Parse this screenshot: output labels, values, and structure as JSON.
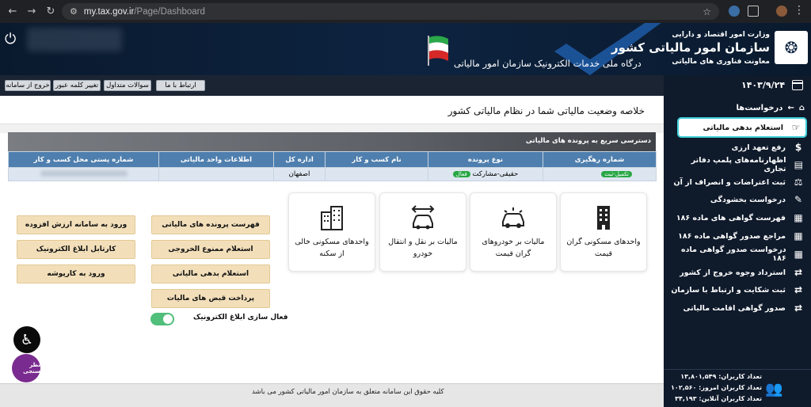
{
  "browser": {
    "url_host": "my.tax.gov.ir",
    "url_path": "/Page/Dashboard"
  },
  "banner": {
    "ministry": "وزارت امور اقتصاد و دارایی",
    "organization": "سازمان امور مالیاتی کشور",
    "deputy": "معاونت فناوری های مالیاتی",
    "portal": "درگاه ملی خدمات الکترونیک سازمان امور مالیاتی"
  },
  "toolbar": {
    "buttons": [
      "ارتباط با ما",
      "سوالات متداول",
      "تغییر کلمه عبور",
      "خروج از سامانه"
    ]
  },
  "main": {
    "title": "خلاصه وضعیت مالیاتی شما در نظام مالیاتی کشور",
    "quick_access_title": "دسترسی سریع به پرونده های مالیاتی",
    "table": {
      "headers": [
        "شماره رهگیری",
        "نوع پرونده",
        "نام کسب و کار",
        "اداره کل",
        "اطلاعات واحد مالیاتی",
        "شماره پستی محل کسب و کار"
      ],
      "row": {
        "tracking_status": "تکمیل-ثبت",
        "file_type": "حقیقی-مشارکت",
        "file_type_badge": "فعال",
        "office": "اصفهان"
      }
    },
    "cards": [
      {
        "icon": "building-icon",
        "text": "واحدهای مسکونی گران قیمت"
      },
      {
        "icon": "car-icon",
        "text": "مالیات بر خودروهای گران قیمت"
      },
      {
        "icon": "car-transfer-icon",
        "text": "مالیات بر نقل و انتقال خودرو"
      },
      {
        "icon": "apartment-icon",
        "text": "واحدهای مسکونی خالی از سکنه"
      }
    ],
    "buttons_col1": [
      "فهرست پرونده های مالیاتی",
      "استعلام ممنوع الخروجی",
      "استعلام بدهی مالیاتی",
      "پرداخت قبض های مالیات"
    ],
    "buttons_col2": [
      "ورود به سامانه ارزش افزوده",
      "کارتابل ابلاغ الکترونیک",
      "ورود به کارپوشه"
    ],
    "toggle_label": "فعال سازی ابلاغ الکترونیک",
    "toggle_on": true,
    "survey_label": "نظر سنجی",
    "footer": "کلیه حقوق این سامانه متعلق به سازمان امور مالیاتی کشور می باشد"
  },
  "sidebar": {
    "date": "۱۴۰۳/۹/۲۴",
    "breadcrumb": "درخواست‌ها",
    "items": [
      {
        "label": "استعلام بدهی مالیاتی",
        "icon": "hand-money-icon",
        "active": true
      },
      {
        "label": "رفع تعهد ارزی",
        "icon": "dollar-icon",
        "active": false
      },
      {
        "label": "اظهارنامه‌های پلمپ دفاتر تجاری",
        "icon": "documents-icon",
        "active": false
      },
      {
        "label": "ثبت اعتراضات و انصراف از آن",
        "icon": "gavel-icon",
        "active": false
      },
      {
        "label": "درخواست بخشودگی",
        "icon": "edit-file-icon",
        "active": false
      },
      {
        "label": "فهرست گواهی های ماده ۱۸۶",
        "icon": "certificate-icon",
        "active": false
      },
      {
        "label": "مراجع صدور گواهی ماده ۱۸۶",
        "icon": "certificate-icon",
        "active": false
      },
      {
        "label": "درخواست صدور گواهی ماده ۱۸۶",
        "icon": "certificate-icon",
        "active": false
      },
      {
        "label": "استرداد وجوه خروج از کشور",
        "icon": "refund-icon",
        "active": false
      },
      {
        "label": "ثبت شکایت و ارتباط با سازمان",
        "icon": "refund-icon",
        "active": false
      },
      {
        "label": "صدور گواهی اقامت مالیاتی",
        "icon": "refund-icon",
        "active": false
      }
    ],
    "stats": {
      "total_users": "تعداد کاربران: ۱۳,۸۰۱,۵۴۹",
      "today_users": "تعداد کاربران امروز: ۱۰۲,۵۶۰",
      "online_users": "تعداد کاربران آنلاین: ۳۴,۱۹۳"
    }
  }
}
